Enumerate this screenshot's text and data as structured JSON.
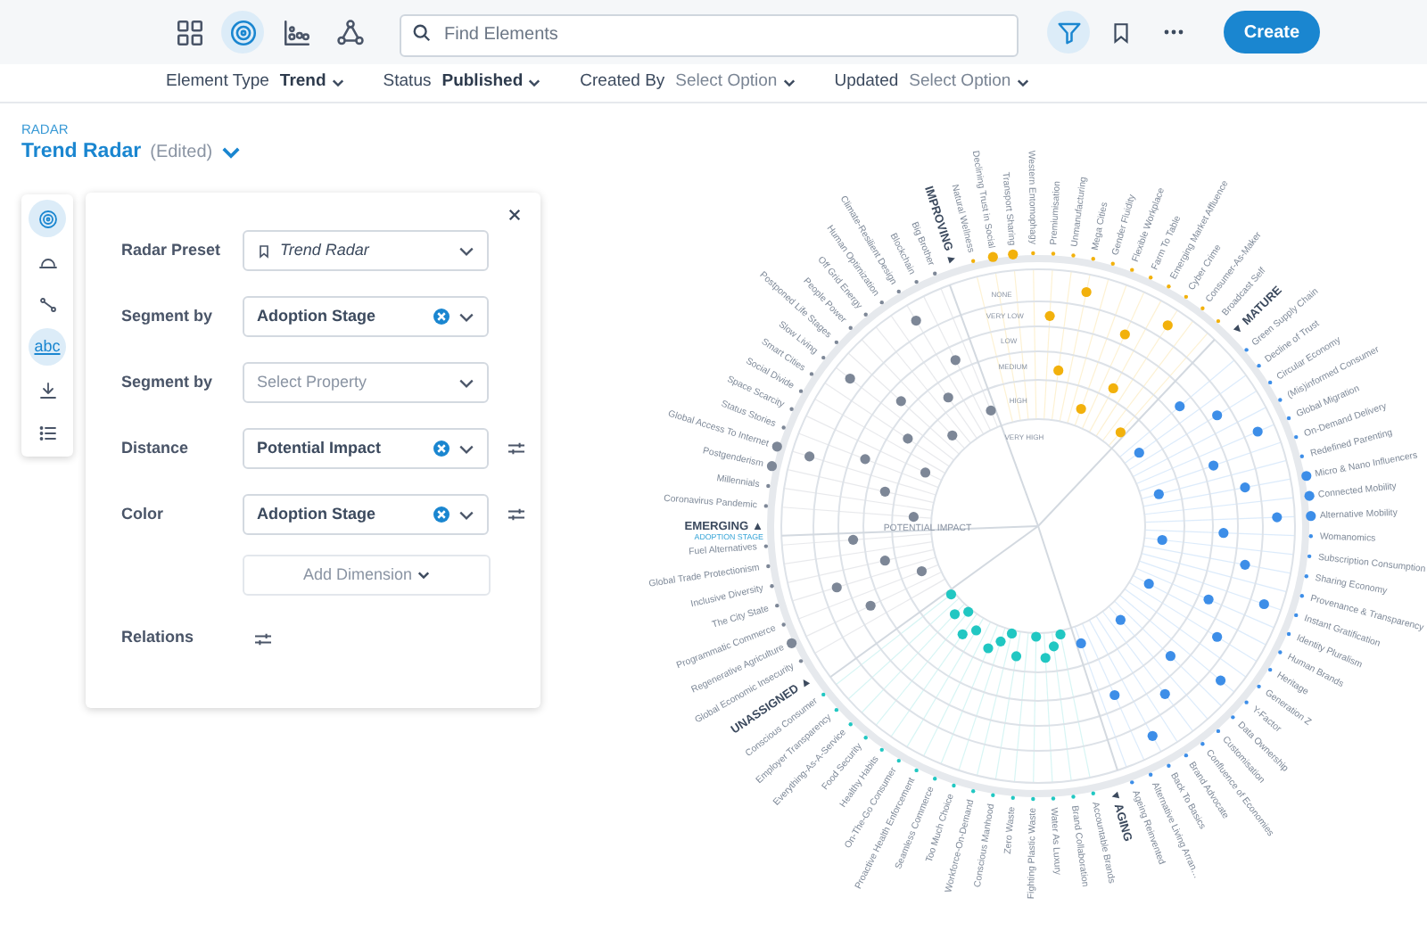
{
  "toolbar": {
    "views": [
      {
        "kind": "grid",
        "selected": false
      },
      {
        "kind": "radar",
        "selected": true
      },
      {
        "kind": "chart",
        "selected": false
      },
      {
        "kind": "network",
        "selected": false
      }
    ],
    "search": {
      "placeholder": "Find Elements"
    },
    "filter_active": true,
    "create_button": "Create"
  },
  "filters": [
    {
      "label": "Element Type",
      "value": "Trend"
    },
    {
      "label": "Status",
      "value": "Published"
    },
    {
      "label": "Created By",
      "placeholder": "Select Option"
    },
    {
      "label": "Updated",
      "placeholder": "Select Option"
    }
  ],
  "header": {
    "section": "RADAR",
    "title": "Trend Radar",
    "note": "(Edited)"
  },
  "side_tools": [
    {
      "kind": "radar",
      "selected": true
    },
    {
      "kind": "arc",
      "selected": false
    },
    {
      "kind": "links",
      "selected": false
    },
    {
      "kind": "text",
      "label": "abc",
      "selected": true
    },
    {
      "kind": "download",
      "selected": false
    },
    {
      "kind": "list",
      "selected": false
    }
  ],
  "settings_panel": {
    "rows": [
      {
        "label": "Radar Preset",
        "kind": "preset",
        "value": "Trend Radar"
      },
      {
        "label": "Segment by",
        "kind": "select",
        "value": "Adoption Stage",
        "clearable": true,
        "adjustable": false
      },
      {
        "label": "Segment by",
        "kind": "select",
        "placeholder": "Select Property",
        "clearable": false,
        "adjustable": false
      },
      {
        "label": "Distance",
        "kind": "select",
        "value": "Potential Impact",
        "clearable": true,
        "adjustable": true
      },
      {
        "label": "Color",
        "kind": "select",
        "value": "Adoption Stage",
        "clearable": true,
        "adjustable": true
      }
    ],
    "add_button": "Add Dimension",
    "relations_label": "Relations"
  },
  "radar": {
    "axis_label": "POTENTIAL IMPACT",
    "segment_caption": "ADOPTION STAGE",
    "distance_levels": [
      "NONE",
      "VERY LOW",
      "LOW",
      "MEDIUM",
      "HIGH",
      "VERY HIGH"
    ],
    "segments": [
      {
        "name": "EMERGING ▲",
        "color": "#7d8797",
        "trends": [
          {
            "label": "Coronavirus Pandemic",
            "highlighted": false
          },
          {
            "label": "Millennials",
            "highlighted": false
          },
          {
            "label": "Postgenderism",
            "highlighted": true
          },
          {
            "label": "Global Access To Internet",
            "highlighted": true
          },
          {
            "label": "Status Stories",
            "highlighted": false
          },
          {
            "label": "Space Scarcity",
            "highlighted": false
          },
          {
            "label": "Social Divide",
            "highlighted": false
          },
          {
            "label": "Smart Cities",
            "highlighted": false
          },
          {
            "label": "Slow Living",
            "highlighted": false
          },
          {
            "label": "Postponed Life Stages",
            "highlighted": false
          },
          {
            "label": "People Power",
            "highlighted": false
          },
          {
            "label": "Off Grid Energy",
            "highlighted": false
          },
          {
            "label": "Human Optimization",
            "highlighted": false
          },
          {
            "label": "Climate-Resilient Design",
            "highlighted": false
          },
          {
            "label": "Blockchain",
            "highlighted": false
          },
          {
            "label": "Big Brother",
            "highlighted": false
          }
        ]
      },
      {
        "name": "IMPROVING ▲",
        "color": "#f2b10c",
        "trends": [
          {
            "label": "Natural Wellness",
            "highlighted": false
          },
          {
            "label": "Declining Trust in Social",
            "highlighted": true
          },
          {
            "label": "Transport Sharing",
            "highlighted": true
          },
          {
            "label": "Western Entomophagy",
            "highlighted": false
          },
          {
            "label": "Premiumisation",
            "highlighted": false
          },
          {
            "label": "Unmanufacturing",
            "highlighted": false
          },
          {
            "label": "Mega Cities",
            "highlighted": false
          },
          {
            "label": "Gender Fluidity",
            "highlighted": false
          },
          {
            "label": "Flexible Workplace",
            "highlighted": false
          },
          {
            "label": "Farm To Table",
            "highlighted": false
          },
          {
            "label": "Emerging Market Affluence",
            "highlighted": false
          },
          {
            "label": "Cyber Crime",
            "highlighted": false
          },
          {
            "label": "Consumer-As-Maker",
            "highlighted": false
          },
          {
            "label": "Broadcast Self",
            "highlighted": false
          }
        ]
      },
      {
        "name": "▼ MATURE",
        "color": "#3d8ee8",
        "trends": [
          {
            "label": "Green Supply Chain",
            "highlighted": false
          },
          {
            "label": "Decline of Trust",
            "highlighted": false
          },
          {
            "label": "Circular Economy",
            "highlighted": false
          },
          {
            "label": "(Mis)informed Consumer",
            "highlighted": false
          },
          {
            "label": "Global Migration",
            "highlighted": false
          },
          {
            "label": "On-Demand Delivery",
            "highlighted": false
          },
          {
            "label": "Redefined Parenting",
            "highlighted": false
          },
          {
            "label": "Micro & Nano Influencers",
            "highlighted": true
          },
          {
            "label": "Connected Mobility",
            "highlighted": true
          },
          {
            "label": "Alternative Mobility",
            "highlighted": true
          },
          {
            "label": "Womanomics",
            "highlighted": false
          },
          {
            "label": "Subscription Consumption",
            "highlighted": false
          },
          {
            "label": "Sharing Economy",
            "highlighted": false
          },
          {
            "label": "Provenance & Transparency",
            "highlighted": false
          },
          {
            "label": "Instant Gratification",
            "highlighted": false
          },
          {
            "label": "Identity Pluralism",
            "highlighted": false
          },
          {
            "label": "Human Brands",
            "highlighted": false
          },
          {
            "label": "Heritage",
            "highlighted": false
          },
          {
            "label": "Generation Z",
            "highlighted": false
          },
          {
            "label": "Y-Factor",
            "highlighted": false
          },
          {
            "label": "Data Ownership",
            "highlighted": false
          },
          {
            "label": "Customisation",
            "highlighted": false
          },
          {
            "label": "Confluence of Economies",
            "highlighted": false
          },
          {
            "label": "Brand Advocate",
            "highlighted": false
          },
          {
            "label": "Back To Basics",
            "highlighted": false
          },
          {
            "label": "Alternative Living Arran…",
            "highlighted": false
          },
          {
            "label": "Ageing Reinvented",
            "highlighted": false
          }
        ]
      },
      {
        "name": "▼ AGING",
        "color": "#21c7c2",
        "trends": [
          {
            "label": "Accountable Brands",
            "highlighted": false
          },
          {
            "label": "Brand Collaboration",
            "highlighted": false
          },
          {
            "label": "Water As Luxury",
            "highlighted": false
          },
          {
            "label": "Fighting Plastic Waste",
            "highlighted": false
          },
          {
            "label": "Zero Waste",
            "highlighted": false
          },
          {
            "label": "Conscious Manhood",
            "highlighted": false
          },
          {
            "label": "Workforce-On-Demand",
            "highlighted": false
          },
          {
            "label": "Too Much Choice",
            "highlighted": false
          },
          {
            "label": "Seamless Commerce",
            "highlighted": false
          },
          {
            "label": "Proactive Health Enforcement",
            "highlighted": false
          },
          {
            "label": "On-The-Go Consumer",
            "highlighted": false
          },
          {
            "label": "Healthy Habits",
            "highlighted": false
          },
          {
            "label": "Food Security",
            "highlighted": false
          },
          {
            "label": "Everything-As-A-Service",
            "highlighted": false
          },
          {
            "label": "Employer Transparency",
            "highlighted": false
          },
          {
            "label": "Conscious Consumer",
            "highlighted": false
          }
        ]
      },
      {
        "name": "UNASSIGNED ▲",
        "color": "#7d8797",
        "trends": [
          {
            "label": "Global Economic Insecurity",
            "highlighted": false
          },
          {
            "label": "Regenerative Agriculture",
            "highlighted": true
          },
          {
            "label": "Programmatic Commerce",
            "highlighted": false
          },
          {
            "label": "The City State",
            "highlighted": false
          },
          {
            "label": "Inclusive Diversity",
            "highlighted": false
          },
          {
            "label": "Global Trade Protectionism",
            "highlighted": false
          },
          {
            "label": "Fuel Alternatives",
            "highlighted": false
          }
        ]
      }
    ]
  }
}
